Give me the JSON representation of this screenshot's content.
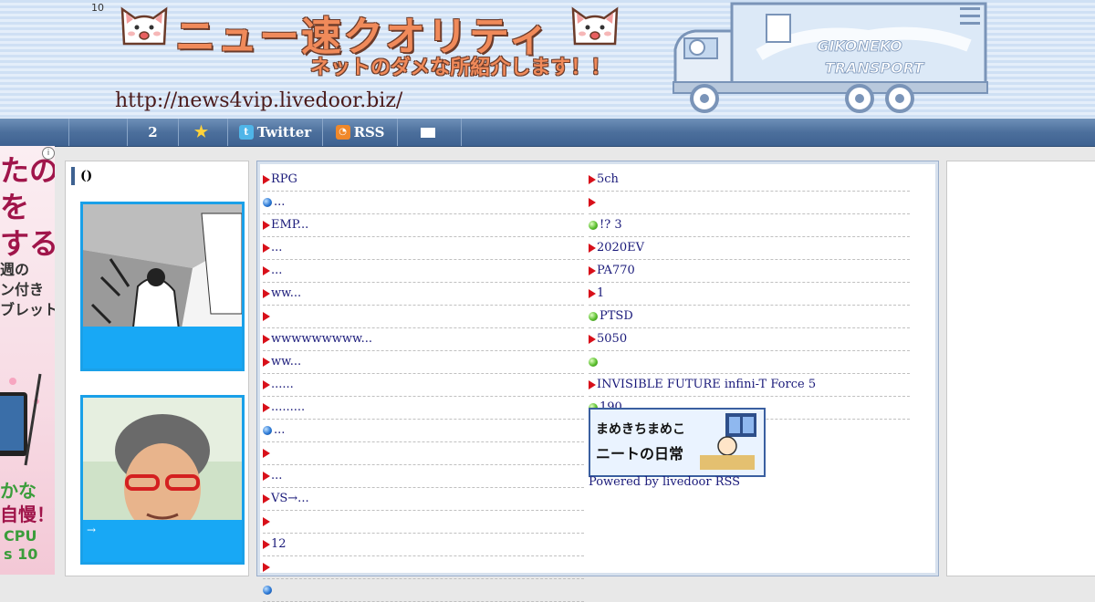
{
  "header": {
    "counter": "10",
    "title": "ニュー速クオリティ",
    "subtitle": "ネットのダメな所紹介します！！",
    "url": "http://news4vip.livedoor.biz/",
    "truck_text_1": "GIKONEKO",
    "truck_text_2": "TRANSPORT"
  },
  "nav": {
    "items": [
      {
        "label": "",
        "icon": "none"
      },
      {
        "label": "",
        "icon": "none"
      },
      {
        "label": "2",
        "icon": "none"
      },
      {
        "label": "",
        "icon": "star-icon"
      },
      {
        "label": "Twitter",
        "icon": "twitter-icon"
      },
      {
        "label": "RSS",
        "icon": "rss-icon"
      },
      {
        "label": "",
        "icon": "mail-icon"
      }
    ]
  },
  "left_ad": {
    "lines": [
      "たの",
      "を",
      "する",
      "週の",
      "ン付き",
      "ブレット",
      "かな",
      "自慢！",
      "CPU",
      "s 10"
    ]
  },
  "left_column": {
    "heading": "()",
    "cards": [
      {
        "caption": ""
      },
      {
        "caption": "→"
      }
    ]
  },
  "feed": {
    "left": [
      {
        "marker": "tri",
        "text": "RPG"
      },
      {
        "marker": "blue",
        "text": "..."
      },
      {
        "marker": "tri",
        "text": "EMP..."
      },
      {
        "marker": "tri",
        "text": "..."
      },
      {
        "marker": "tri",
        "text": "..."
      },
      {
        "marker": "tri",
        "text": "ww..."
      },
      {
        "marker": "tri",
        "text": ""
      },
      {
        "marker": "tri",
        "text": "wwwwwwwww..."
      },
      {
        "marker": "tri",
        "text": "ww..."
      },
      {
        "marker": "tri",
        "text": "......"
      },
      {
        "marker": "tri",
        "text": "........."
      },
      {
        "marker": "blue",
        "text": "..."
      },
      {
        "marker": "tri",
        "text": ""
      },
      {
        "marker": "tri",
        "text": "..."
      },
      {
        "marker": "tri",
        "text": "VS→..."
      },
      {
        "marker": "tri",
        "text": ""
      },
      {
        "marker": "tri",
        "text": "12"
      },
      {
        "marker": "tri",
        "text": ""
      },
      {
        "marker": "blue",
        "text": ""
      }
    ],
    "right": [
      {
        "marker": "tri",
        "text": "5ch"
      },
      {
        "marker": "tri",
        "text": ""
      },
      {
        "marker": "green",
        "text": "!? 3"
      },
      {
        "marker": "tri",
        "text": "2020EV"
      },
      {
        "marker": "tri",
        "text": "PA770"
      },
      {
        "marker": "tri",
        "text": "1"
      },
      {
        "marker": "green",
        "text": "PTSD"
      },
      {
        "marker": "tri",
        "text": "5050"
      },
      {
        "marker": "green",
        "text": ""
      },
      {
        "marker": "tri",
        "text": "INVISIBLE FUTURE infini-T Force 5"
      },
      {
        "marker": "green",
        "text": "190"
      }
    ],
    "banner_line1": "まめきちまめこ",
    "banner_line2": "ニートの日常",
    "powered_by": "Powered by livedoor RSS"
  },
  "colors": {
    "nav_bg": "#4c6f9c",
    "link": "#1a1a7a",
    "marker_red": "#d8101a",
    "card_border": "#1aa0e8",
    "card_overlay": "#18a8f5"
  }
}
